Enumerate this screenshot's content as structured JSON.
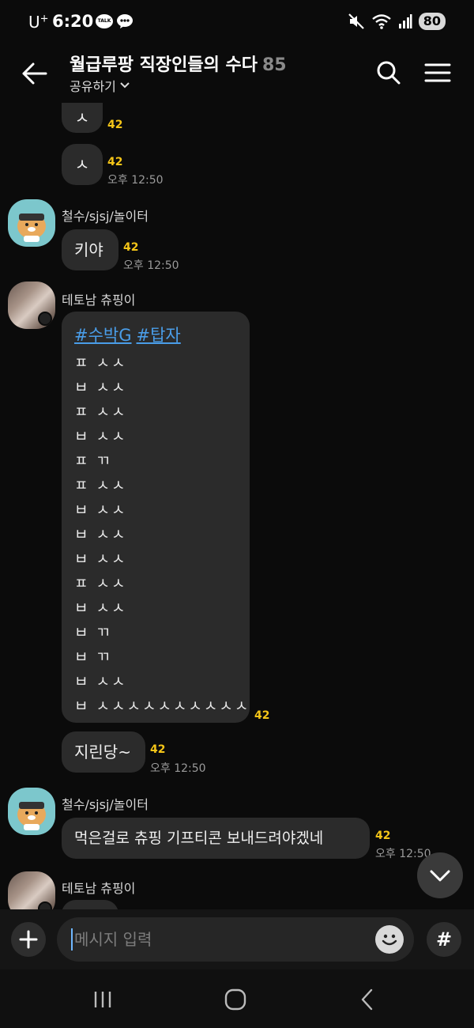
{
  "status_bar": {
    "carrier": "U",
    "carrier_sup": "+",
    "time": "6:20",
    "talk_badge": "TALK",
    "battery": "80"
  },
  "header": {
    "title": "월급루팡 직장인들의 수다",
    "member_count": "85",
    "share_label": "공유하기"
  },
  "messages": [
    {
      "type": "text",
      "text": "ㅅ",
      "unread": "42"
    },
    {
      "type": "text",
      "text": "ㅅ",
      "unread": "42",
      "time": "오후 12:50"
    },
    {
      "type": "sender",
      "name": "철수/sjsj/놀이터"
    },
    {
      "type": "text",
      "text": "키야",
      "unread": "42",
      "time": "오후 12:50"
    },
    {
      "type": "sender",
      "name": "테토남 츄핑이"
    },
    {
      "type": "long",
      "hashtags": [
        "#수박G",
        "#탑자"
      ],
      "lines": [
        "ㅍ ㅅㅅ",
        "ㅂ ㅅㅅ",
        "ㅍ ㅅㅅ",
        "ㅂ ㅅㅅ",
        "ㅍ ㄲ",
        "ㅍ ㅅㅅ",
        "ㅂ ㅅㅅ",
        "ㅂ ㅅㅅ",
        "ㅂ ㅅㅅ",
        "ㅍ ㅅㅅ",
        "ㅂ ㅅㅅ",
        "ㅂ ㄲ",
        "ㅂ ㄲ",
        "ㅂ ㅅㅅ",
        "ㅂ ㅅㅅㅅㅅㅅㅅㅅㅅㅅㅅ"
      ],
      "unread": "42"
    },
    {
      "type": "text",
      "text": "지린당~",
      "unread": "42",
      "time": "오후 12:50"
    },
    {
      "type": "sender",
      "name": "철수/sjsj/놀이터"
    },
    {
      "type": "text",
      "text": "먹은걸로 츄핑 기프티콘 보내드려야겠네",
      "unread": "42",
      "time": "오후 12:50"
    },
    {
      "type": "sender",
      "name": "테토남 츄핑이"
    }
  ],
  "input": {
    "placeholder": "메시지 입력",
    "hash_label": "#"
  },
  "colors": {
    "background": "#0b0b0b",
    "bubble": "#2b2b2b",
    "unread": "#f5c518",
    "hashtag": "#4a9de8",
    "avatar_ryan": "#7cc7cc"
  },
  "icons": {
    "back": "arrow-left-icon",
    "search": "search-icon",
    "menu": "hamburger-icon",
    "scroll_down": "chevron-down-icon",
    "plus": "plus-icon",
    "emoji": "emoji-icon",
    "nav_recent": "recent-apps-icon",
    "nav_home": "home-icon",
    "nav_back": "nav-back-icon"
  }
}
